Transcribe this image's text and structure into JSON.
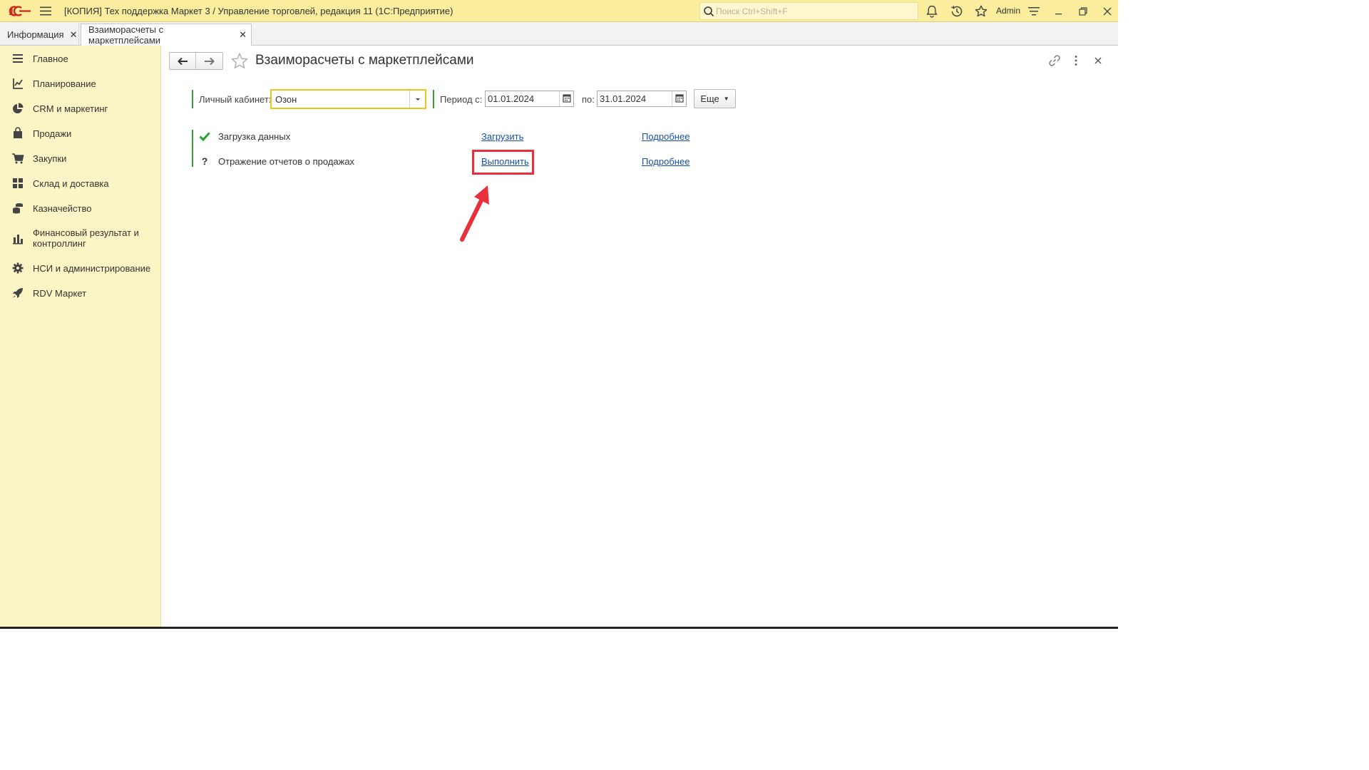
{
  "titlebar": {
    "app_title": "[КОПИЯ] Тех поддержка Маркет 3 / Управление торговлей, редакция 11  (1С:Предприятие)",
    "search_placeholder": "Поиск Ctrl+Shift+F",
    "user": "Admin"
  },
  "tabs": [
    {
      "label": "Информация",
      "active": false
    },
    {
      "label": "Взаиморасчеты с маркетплейсами",
      "active": true
    }
  ],
  "sidebar": {
    "items": [
      {
        "label": "Главное",
        "icon": "menu-lines-icon"
      },
      {
        "label": "Планирование",
        "icon": "planning-icon"
      },
      {
        "label": "CRM и маркетинг",
        "icon": "pie-chart-icon"
      },
      {
        "label": "Продажи",
        "icon": "shopping-bag-icon"
      },
      {
        "label": "Закупки",
        "icon": "cart-icon"
      },
      {
        "label": "Склад и доставка",
        "icon": "warehouse-icon"
      },
      {
        "label": "Казначейство",
        "icon": "coins-icon"
      },
      {
        "label": "Финансовый результат и",
        "label2": "контроллинг",
        "icon": "bar-chart-icon"
      },
      {
        "label": "НСИ и администрирование",
        "icon": "gear-icon"
      },
      {
        "label": "RDV Маркет",
        "icon": "rocket-icon"
      }
    ]
  },
  "page": {
    "title": "Взаиморасчеты с маркетплейсами",
    "filters": {
      "cabinet_label": "Личный кабинет:",
      "cabinet_value": "Озон",
      "period_from_label": "Период с:",
      "period_from": "01.01.2024",
      "period_to_label": "по:",
      "period_to": "31.01.2024",
      "more_label": "Еще"
    },
    "tasks": [
      {
        "status": "done",
        "status_icon": "checkmark-icon",
        "name": "Загрузка данных",
        "action": "Загрузить",
        "details": "Подробнее"
      },
      {
        "status": "?",
        "status_icon": "question-icon",
        "name": "Отражение отчетов о продажах",
        "action": "Выполнить",
        "details": "Подробнее"
      }
    ]
  },
  "colors": {
    "titlebar_bg": "#fbed9e",
    "sidebar_bg": "#fbf4c4",
    "accent_green": "#3b9b3b",
    "link": "#1a4fa8",
    "combo_border": "#f0c21d",
    "annotation_red": "#e8303d"
  }
}
